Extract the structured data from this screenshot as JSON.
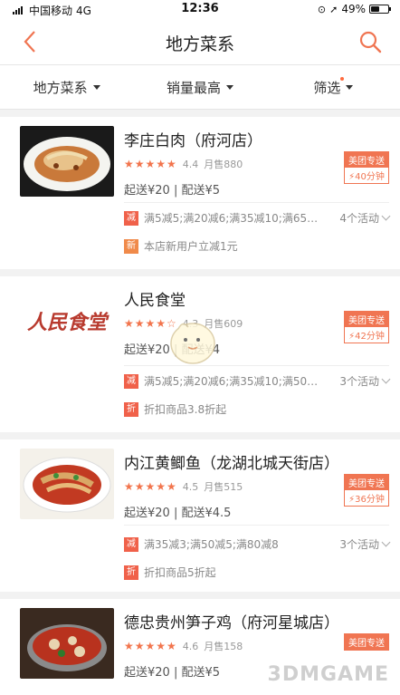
{
  "status": {
    "carrier": "中国移动",
    "network": "4G",
    "time": "12:36",
    "battery": "49%",
    "battery_level": 0.49
  },
  "nav": {
    "title": "地方菜系"
  },
  "filters": [
    {
      "label": "地方菜系"
    },
    {
      "label": "销量最高"
    },
    {
      "label": "筛选"
    }
  ],
  "shops": [
    {
      "name": "李庄白肉（府河店）",
      "rating": "4.4",
      "sales": "月售880",
      "delivery": "起送¥20 | 配送¥5",
      "badge": "美团专送",
      "eta": "⚡40分钟",
      "act1_tag": "减",
      "act1_text": "满5减5;满20减6;满35减10;满65…",
      "act1_more": "4个活动",
      "act2_tag": "新",
      "act2_text": "本店新用户立减1元"
    },
    {
      "name": "人民食堂",
      "logo_text": "人民食堂",
      "rating": "4.3",
      "sales": "月售609",
      "delivery": "起送¥20 | 配送¥4",
      "badge": "美团专送",
      "eta": "⚡42分钟",
      "act1_tag": "减",
      "act1_text": "满5减5;满20减6;满35减10;满50…",
      "act1_more": "3个活动",
      "act2_tag": "折",
      "act2_text": "折扣商品3.8折起"
    },
    {
      "name": "内江黄鲫鱼（龙湖北城天街店）",
      "rating": "4.5",
      "sales": "月售515",
      "delivery": "起送¥20 | 配送¥4.5",
      "badge": "美团专送",
      "eta": "⚡36分钟",
      "act1_tag": "减",
      "act1_text": "满35减3;满50减5;满80减8",
      "act1_more": "3个活动",
      "act2_tag": "折",
      "act2_text": "折扣商品5折起"
    },
    {
      "name": "德忠贵州笋子鸡（府河星城店）",
      "rating": "4.6",
      "sales": "月售158",
      "delivery": "起送¥20 | 配送¥5",
      "badge": "美团专送"
    }
  ],
  "watermark": "3DMGAME",
  "colors": {
    "accent": "#f07552",
    "star": "#f2744c"
  }
}
